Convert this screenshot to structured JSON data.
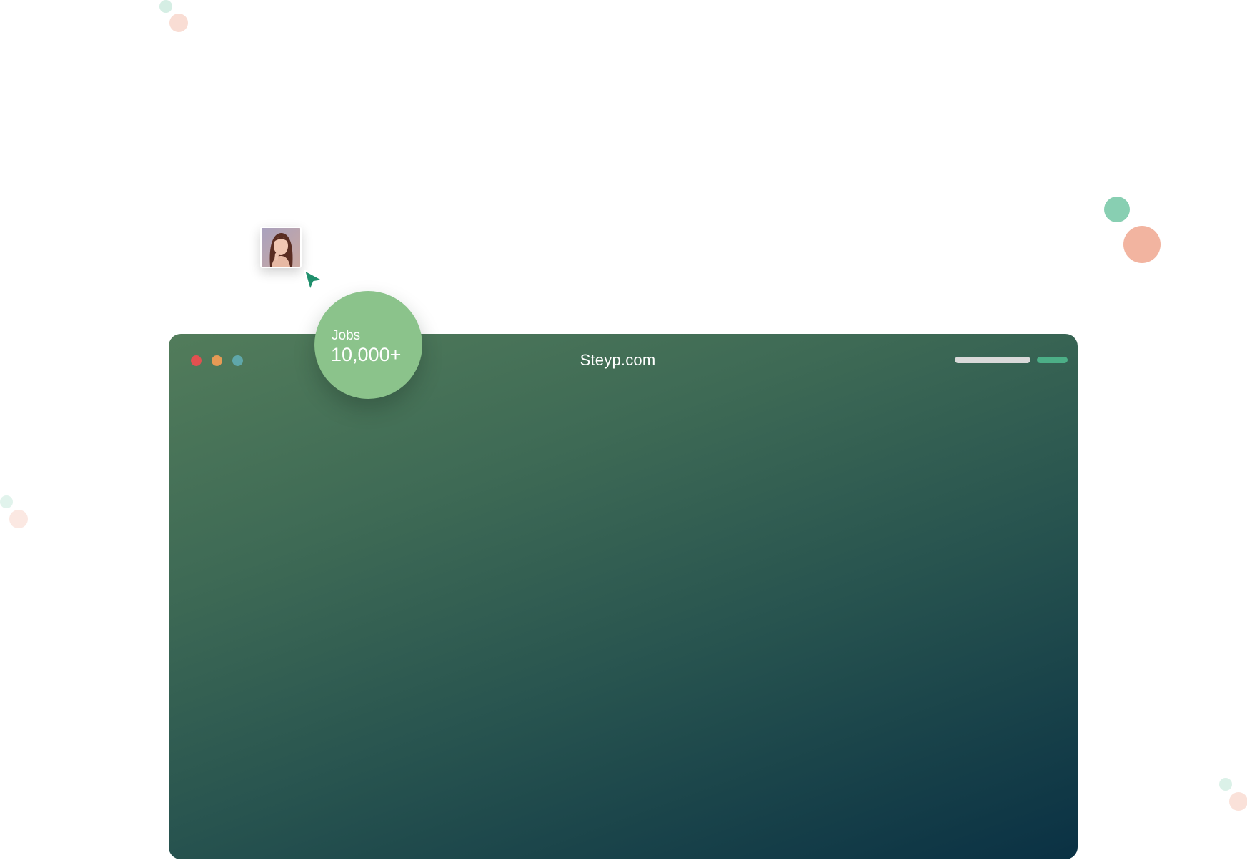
{
  "browser": {
    "site_title": "Steyp.com",
    "window_controls": {
      "close_color": "#e25050",
      "minimize_color": "#e69a55",
      "maximize_color": "#5fa7aa"
    },
    "toolbar_bar_color": "#d9d9d9",
    "toolbar_accent_color": "#4caf87"
  },
  "stat_badge": {
    "label": "Jobs",
    "value": "10,000+",
    "color": "#8bc38b"
  },
  "avatar": {
    "icon": "profile-photo"
  },
  "cursor": {
    "icon": "pointer-arrow-icon",
    "color": "#1f8f6c"
  },
  "theme": {
    "mint": "#88cfb2",
    "peach": "#f2b4a0",
    "gradient_start": "#527c5b",
    "gradient_end": "#0a3144"
  }
}
